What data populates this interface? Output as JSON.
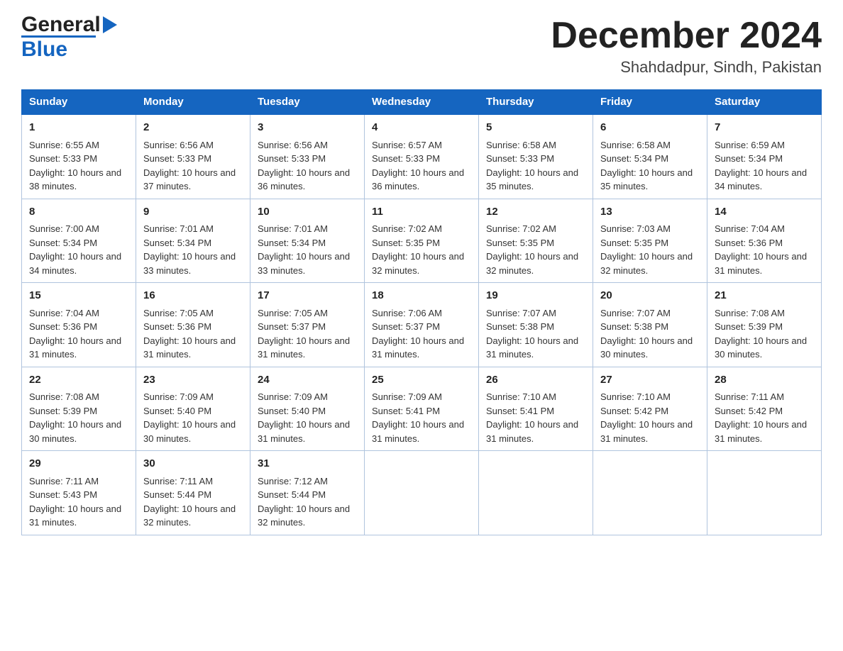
{
  "logo": {
    "text_general": "General",
    "text_blue": "Blue"
  },
  "title": "December 2024",
  "location": "Shahdadpur, Sindh, Pakistan",
  "days_of_week": [
    "Sunday",
    "Monday",
    "Tuesday",
    "Wednesday",
    "Thursday",
    "Friday",
    "Saturday"
  ],
  "weeks": [
    [
      {
        "day": "1",
        "sunrise": "6:55 AM",
        "sunset": "5:33 PM",
        "daylight": "10 hours and 38 minutes."
      },
      {
        "day": "2",
        "sunrise": "6:56 AM",
        "sunset": "5:33 PM",
        "daylight": "10 hours and 37 minutes."
      },
      {
        "day": "3",
        "sunrise": "6:56 AM",
        "sunset": "5:33 PM",
        "daylight": "10 hours and 36 minutes."
      },
      {
        "day": "4",
        "sunrise": "6:57 AM",
        "sunset": "5:33 PM",
        "daylight": "10 hours and 36 minutes."
      },
      {
        "day": "5",
        "sunrise": "6:58 AM",
        "sunset": "5:33 PM",
        "daylight": "10 hours and 35 minutes."
      },
      {
        "day": "6",
        "sunrise": "6:58 AM",
        "sunset": "5:34 PM",
        "daylight": "10 hours and 35 minutes."
      },
      {
        "day": "7",
        "sunrise": "6:59 AM",
        "sunset": "5:34 PM",
        "daylight": "10 hours and 34 minutes."
      }
    ],
    [
      {
        "day": "8",
        "sunrise": "7:00 AM",
        "sunset": "5:34 PM",
        "daylight": "10 hours and 34 minutes."
      },
      {
        "day": "9",
        "sunrise": "7:01 AM",
        "sunset": "5:34 PM",
        "daylight": "10 hours and 33 minutes."
      },
      {
        "day": "10",
        "sunrise": "7:01 AM",
        "sunset": "5:34 PM",
        "daylight": "10 hours and 33 minutes."
      },
      {
        "day": "11",
        "sunrise": "7:02 AM",
        "sunset": "5:35 PM",
        "daylight": "10 hours and 32 minutes."
      },
      {
        "day": "12",
        "sunrise": "7:02 AM",
        "sunset": "5:35 PM",
        "daylight": "10 hours and 32 minutes."
      },
      {
        "day": "13",
        "sunrise": "7:03 AM",
        "sunset": "5:35 PM",
        "daylight": "10 hours and 32 minutes."
      },
      {
        "day": "14",
        "sunrise": "7:04 AM",
        "sunset": "5:36 PM",
        "daylight": "10 hours and 31 minutes."
      }
    ],
    [
      {
        "day": "15",
        "sunrise": "7:04 AM",
        "sunset": "5:36 PM",
        "daylight": "10 hours and 31 minutes."
      },
      {
        "day": "16",
        "sunrise": "7:05 AM",
        "sunset": "5:36 PM",
        "daylight": "10 hours and 31 minutes."
      },
      {
        "day": "17",
        "sunrise": "7:05 AM",
        "sunset": "5:37 PM",
        "daylight": "10 hours and 31 minutes."
      },
      {
        "day": "18",
        "sunrise": "7:06 AM",
        "sunset": "5:37 PM",
        "daylight": "10 hours and 31 minutes."
      },
      {
        "day": "19",
        "sunrise": "7:07 AM",
        "sunset": "5:38 PM",
        "daylight": "10 hours and 31 minutes."
      },
      {
        "day": "20",
        "sunrise": "7:07 AM",
        "sunset": "5:38 PM",
        "daylight": "10 hours and 30 minutes."
      },
      {
        "day": "21",
        "sunrise": "7:08 AM",
        "sunset": "5:39 PM",
        "daylight": "10 hours and 30 minutes."
      }
    ],
    [
      {
        "day": "22",
        "sunrise": "7:08 AM",
        "sunset": "5:39 PM",
        "daylight": "10 hours and 30 minutes."
      },
      {
        "day": "23",
        "sunrise": "7:09 AM",
        "sunset": "5:40 PM",
        "daylight": "10 hours and 30 minutes."
      },
      {
        "day": "24",
        "sunrise": "7:09 AM",
        "sunset": "5:40 PM",
        "daylight": "10 hours and 31 minutes."
      },
      {
        "day": "25",
        "sunrise": "7:09 AM",
        "sunset": "5:41 PM",
        "daylight": "10 hours and 31 minutes."
      },
      {
        "day": "26",
        "sunrise": "7:10 AM",
        "sunset": "5:41 PM",
        "daylight": "10 hours and 31 minutes."
      },
      {
        "day": "27",
        "sunrise": "7:10 AM",
        "sunset": "5:42 PM",
        "daylight": "10 hours and 31 minutes."
      },
      {
        "day": "28",
        "sunrise": "7:11 AM",
        "sunset": "5:42 PM",
        "daylight": "10 hours and 31 minutes."
      }
    ],
    [
      {
        "day": "29",
        "sunrise": "7:11 AM",
        "sunset": "5:43 PM",
        "daylight": "10 hours and 31 minutes."
      },
      {
        "day": "30",
        "sunrise": "7:11 AM",
        "sunset": "5:44 PM",
        "daylight": "10 hours and 32 minutes."
      },
      {
        "day": "31",
        "sunrise": "7:12 AM",
        "sunset": "5:44 PM",
        "daylight": "10 hours and 32 minutes."
      },
      null,
      null,
      null,
      null
    ]
  ]
}
